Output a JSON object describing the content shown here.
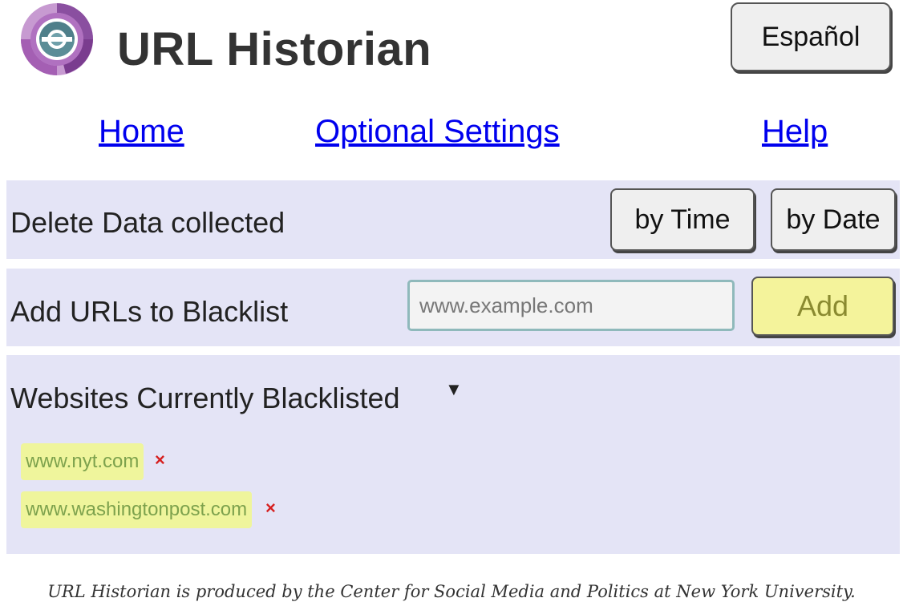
{
  "header": {
    "logo_icon": "url-historian-logo-icon",
    "title": "URL Historian",
    "language_button": "Español"
  },
  "nav": {
    "home": "Home",
    "optional_settings": "Optional Settings",
    "help": "Help"
  },
  "delete_panel": {
    "label": "Delete Data collected",
    "by_time": "by Time",
    "by_date": "by Date"
  },
  "blacklist_panel": {
    "label": "Add URLs to Blacklist",
    "input_value": "",
    "input_placeholder": "www.example.com",
    "add_label": "Add"
  },
  "blacklisted_panel": {
    "label": "Websites Currently Blacklisted",
    "toggle_icon": "triangle-down-icon",
    "remove_icon": "close-x-icon",
    "items": [
      {
        "url": "www.nyt.com"
      },
      {
        "url": "www.washingtonpost.com"
      }
    ]
  },
  "footer": {
    "text": "URL Historian is produced by the Center for Social Media and Politics at New York University."
  },
  "colors": {
    "panel_bg": "#e4e4f6",
    "link": "#0000ee",
    "add_button_bg": "#f4f39b",
    "tag_bg": "#eff59c",
    "tag_text": "#7da24d",
    "remove_x": "#d62020",
    "logo_purple": "#8a4fa0",
    "logo_teal": "#4f8a92"
  }
}
